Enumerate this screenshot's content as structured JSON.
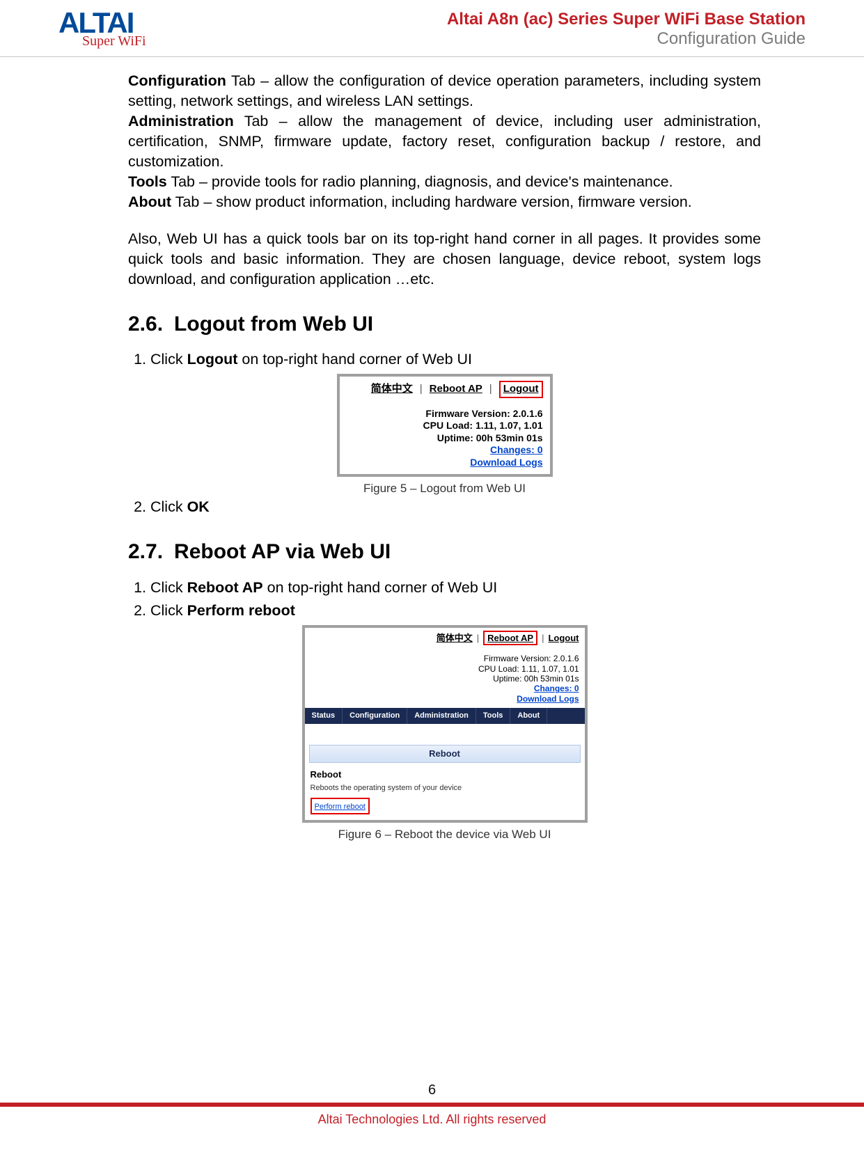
{
  "header": {
    "logo_main": "ALTAI",
    "logo_sub": "Super WiFi",
    "title_red": "Altai A8n (ac) Series Super WiFi Base Station",
    "title_gray": "Configuration Guide"
  },
  "body": {
    "tabs_intro": {
      "configuration_bold": "Configuration",
      "configuration_text": " Tab – allow the configuration of device operation parameters, including system setting, network settings, and wireless LAN settings.",
      "administration_bold": "Administration",
      "administration_text": " Tab – allow the management of device, including user administration, certification, SNMP, firmware update, factory reset, configuration backup / restore, and customization.",
      "tools_bold": "Tools",
      "tools_text": " Tab – provide tools for radio planning, diagnosis, and device's maintenance.",
      "about_bold": "About",
      "about_text": " Tab – show product information, including hardware version, firmware version.",
      "also_para": "Also, Web UI has a quick tools bar on its top-right hand corner in all pages. It provides some quick tools and basic information. They are chosen language, device reboot, system logs download, and configuration application …etc."
    },
    "s26": {
      "num": "2.6.",
      "title": "Logout from Web UI",
      "step1_pre": "Click ",
      "step1_bold": "Logout",
      "step1_post": " on top-right hand corner of Web UI",
      "step2_pre": "Click ",
      "step2_bold": "OK"
    },
    "fig5": {
      "lang_cn": "简体中文",
      "divider": "|",
      "reboot_label": "Reboot AP",
      "logout_label": "Logout",
      "fw_version": "Firmware Version: 2.0.1.6",
      "cpu_load": "CPU Load: 1.11, 1.07, 1.01",
      "uptime": "Uptime: 00h 53min 01s",
      "changes": "Changes: 0",
      "download_logs": "Download Logs",
      "caption": "Figure 5 – Logout from Web UI"
    },
    "s27": {
      "num": "2.7.",
      "title": "Reboot AP via Web UI",
      "step1_pre": "Click ",
      "step1_bold": "Reboot AP",
      "step1_post": " on top-right hand corner of Web UI",
      "step2_pre": "Click ",
      "step2_bold": "Perform reboot"
    },
    "fig6": {
      "lang_cn": "简体中文",
      "divider": "|",
      "reboot_label": "Reboot AP",
      "logout_label": "Logout",
      "fw_version": "Firmware Version: 2.0.1.6",
      "cpu_load": "CPU Load: 1.11, 1.07, 1.01",
      "uptime": "Uptime: 00h 53min 01s",
      "changes": "Changes: 0",
      "download_logs": "Download Logs",
      "tabs": {
        "status": "Status",
        "configuration": "Configuration",
        "administration": "Administration",
        "tools": "Tools",
        "about": "About"
      },
      "reboot_bar": "Reboot",
      "reboot_section": "Reboot",
      "reboot_desc": "Reboots the operating system of your device",
      "perform_reboot": "Perform reboot",
      "caption": "Figure 6 – Reboot the device via Web UI"
    }
  },
  "footer": {
    "page_number": "6",
    "copyright": "Altai Technologies Ltd. All rights reserved"
  }
}
